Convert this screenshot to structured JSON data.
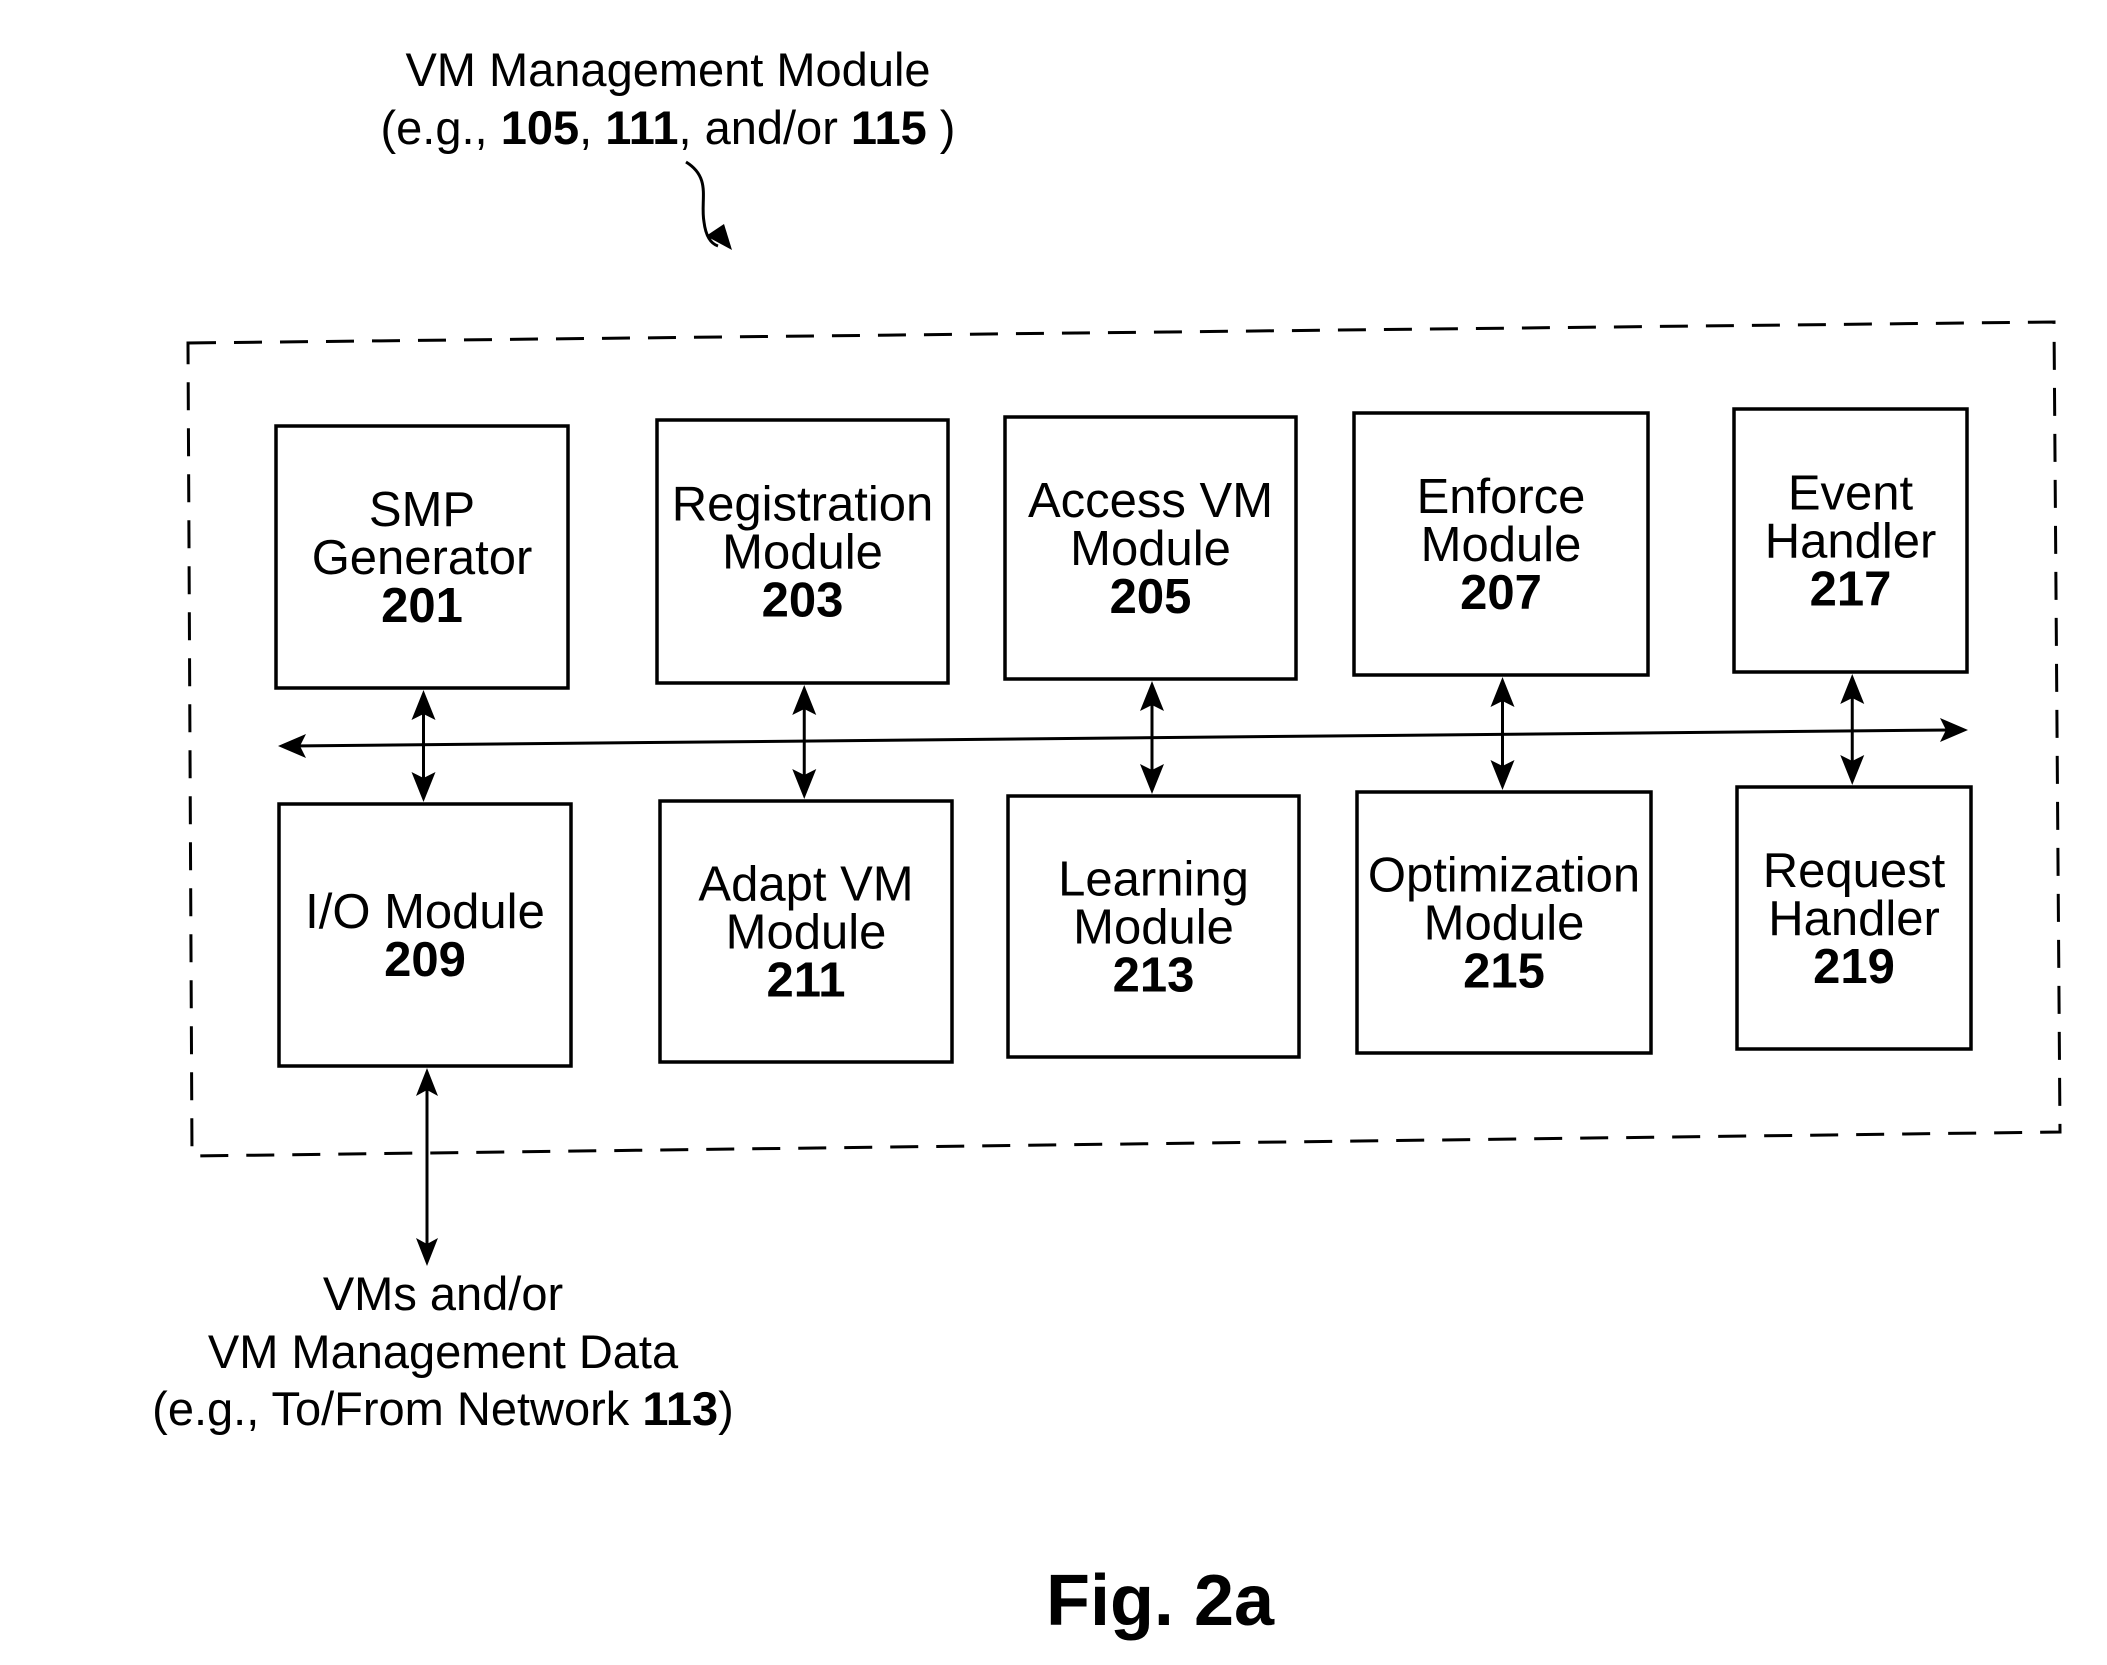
{
  "header": {
    "title": "VM Management Module",
    "subtitle_parts": [
      {
        "text": "(e.g., ",
        "bold": false
      },
      {
        "text": "105",
        "bold": true
      },
      {
        "text": ", ",
        "bold": false
      },
      {
        "text": "111",
        "bold": true
      },
      {
        "text": ", and/or ",
        "bold": false
      },
      {
        "text": "115",
        "bold": true
      },
      {
        "text": " )",
        "bold": false
      }
    ]
  },
  "modules": {
    "top": [
      {
        "lines": [
          "SMP",
          "Generator"
        ],
        "ref": "201"
      },
      {
        "lines": [
          "Registration",
          "Module"
        ],
        "ref": "203"
      },
      {
        "lines": [
          "Access VM",
          "Module"
        ],
        "ref": "205"
      },
      {
        "lines": [
          "Enforce",
          "Module"
        ],
        "ref": "207"
      },
      {
        "lines": [
          "Event",
          "Handler"
        ],
        "ref": "217"
      }
    ],
    "bottom": [
      {
        "lines": [
          "I/O Module"
        ],
        "ref": "209"
      },
      {
        "lines": [
          "Adapt VM",
          "Module"
        ],
        "ref": "211"
      },
      {
        "lines": [
          "Learning",
          "Module"
        ],
        "ref": "213"
      },
      {
        "lines": [
          "Optimization",
          "Module"
        ],
        "ref": "215"
      },
      {
        "lines": [
          "Request",
          "Handler"
        ],
        "ref": "219"
      }
    ]
  },
  "external": {
    "line1": "VMs and/or",
    "line2": "VM Management Data",
    "line3_parts": [
      {
        "text": "(e.g., To/From Network ",
        "bold": false
      },
      {
        "text": "113",
        "bold": true
      },
      {
        "text": ")",
        "bold": false
      }
    ]
  },
  "figure_label": "Fig. 2a"
}
